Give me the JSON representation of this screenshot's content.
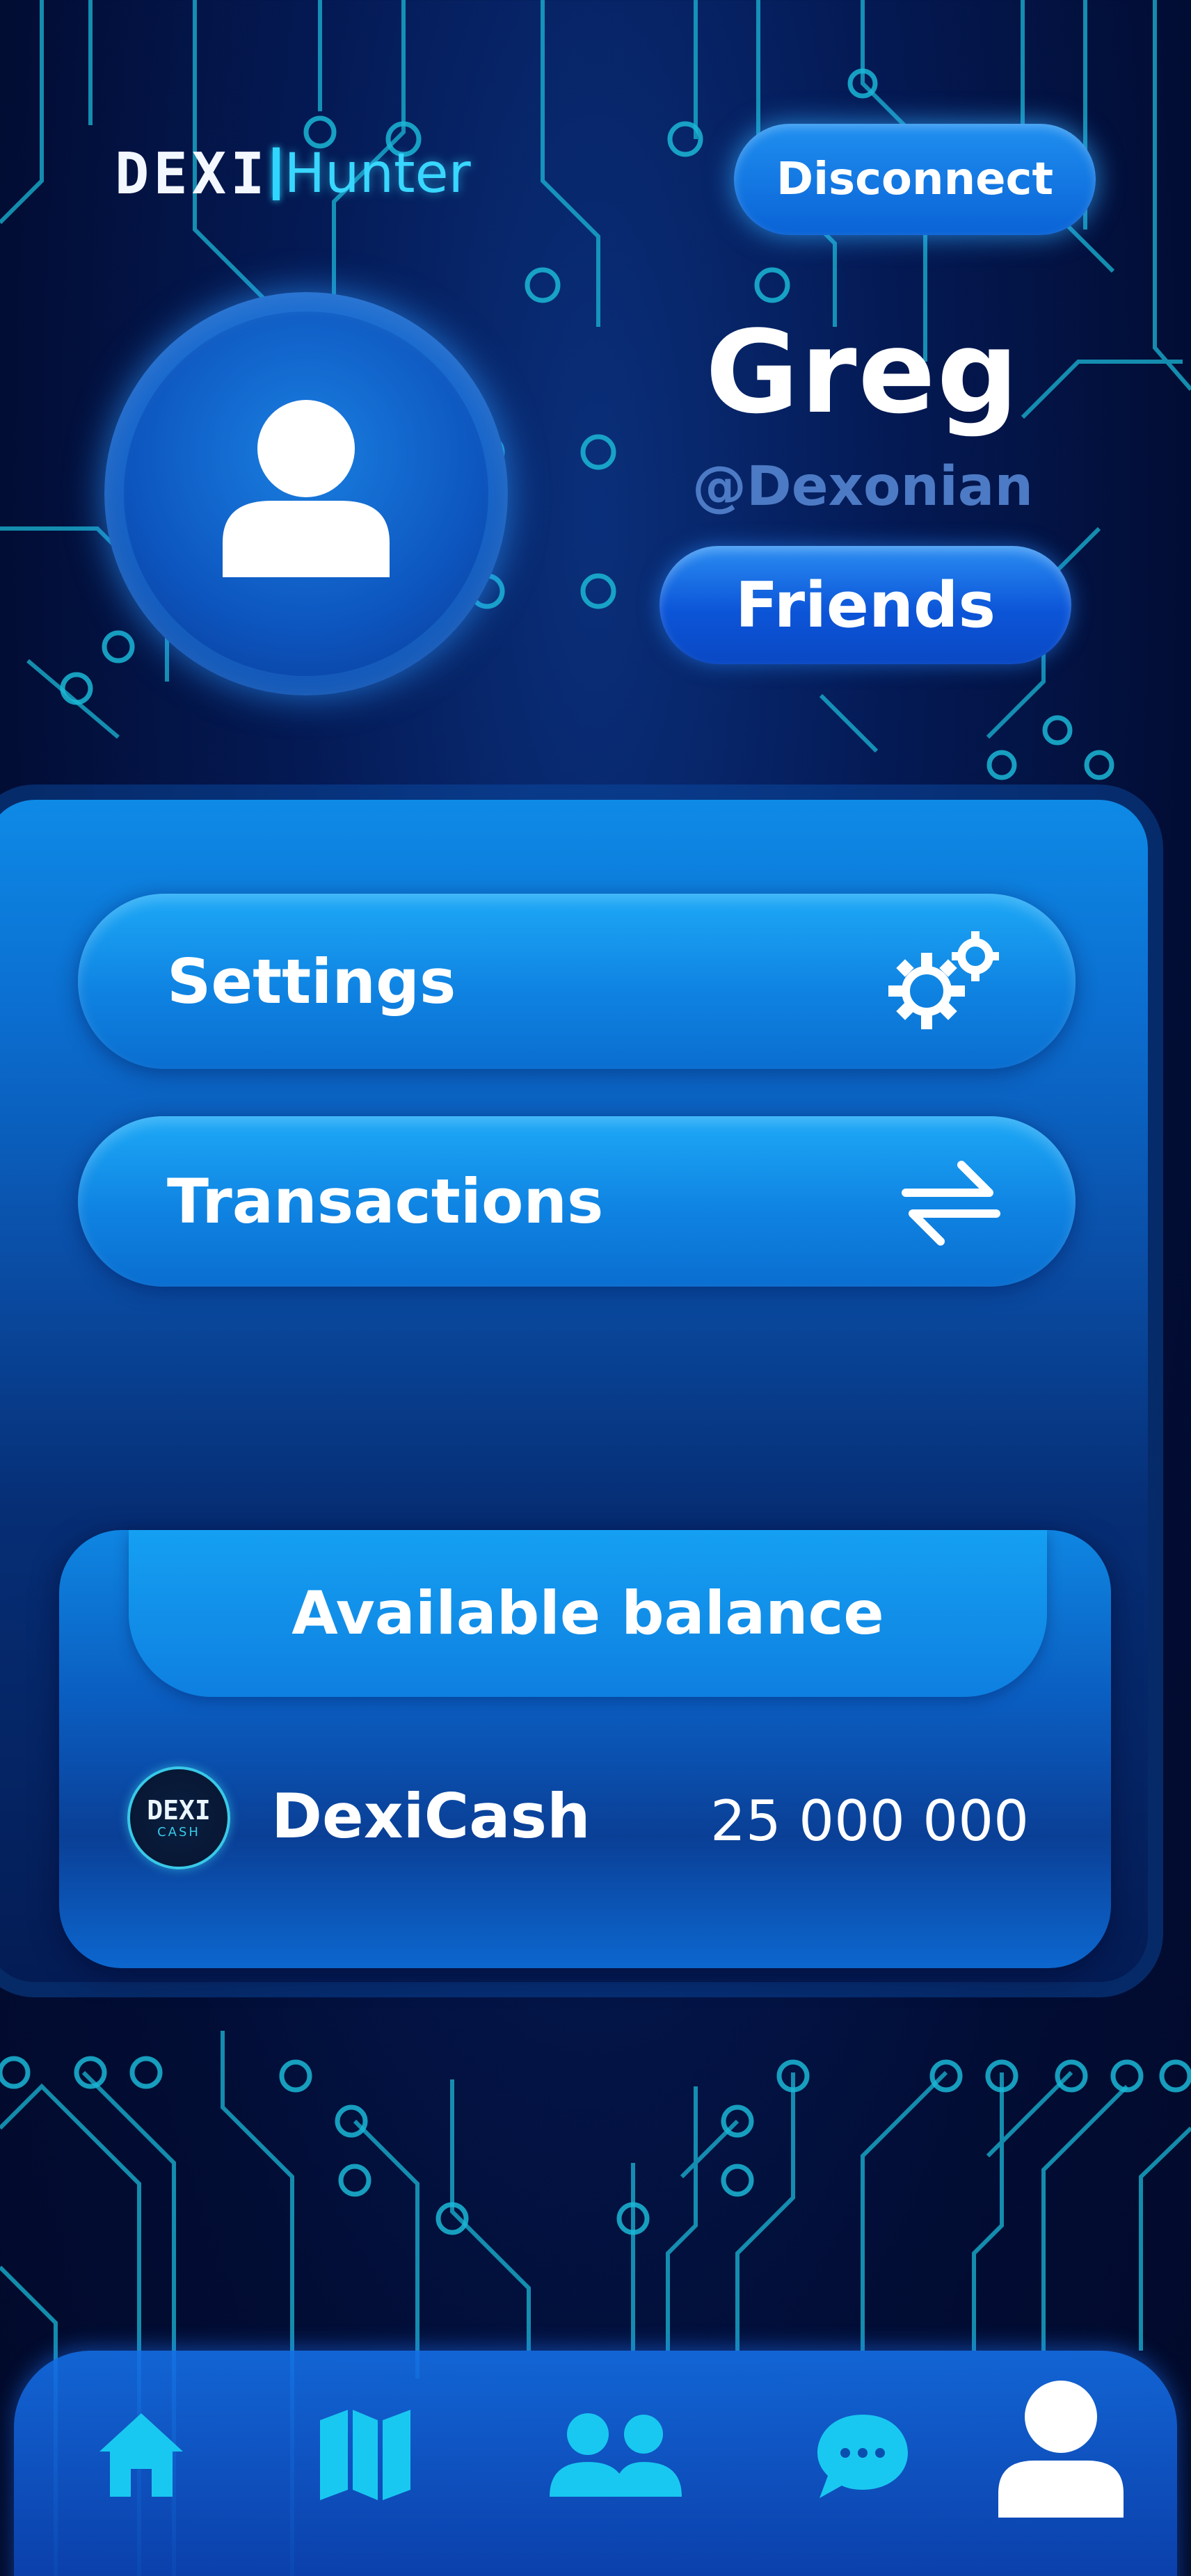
{
  "brand": {
    "logo_left": "DEXI",
    "logo_right": "Hunter"
  },
  "header": {
    "disconnect_label": "Disconnect"
  },
  "profile": {
    "name": "Greg",
    "handle": "@Dexonian",
    "friends_label": "Friends"
  },
  "menu": {
    "settings_label": "Settings",
    "transactions_label": "Transactions"
  },
  "balance": {
    "title": "Available balance",
    "coin_top": "DEXI",
    "coin_bottom": "CASH",
    "currency": "DexiCash",
    "amount": "25 000 000"
  },
  "nav": {
    "items": [
      "home-icon",
      "map-icon",
      "friends-icon",
      "chat-icon",
      "profile-icon"
    ],
    "active": "profile-icon"
  },
  "colors": {
    "accent": "#2fd6ff",
    "button": "#0f83e2",
    "background": "#041a55"
  }
}
